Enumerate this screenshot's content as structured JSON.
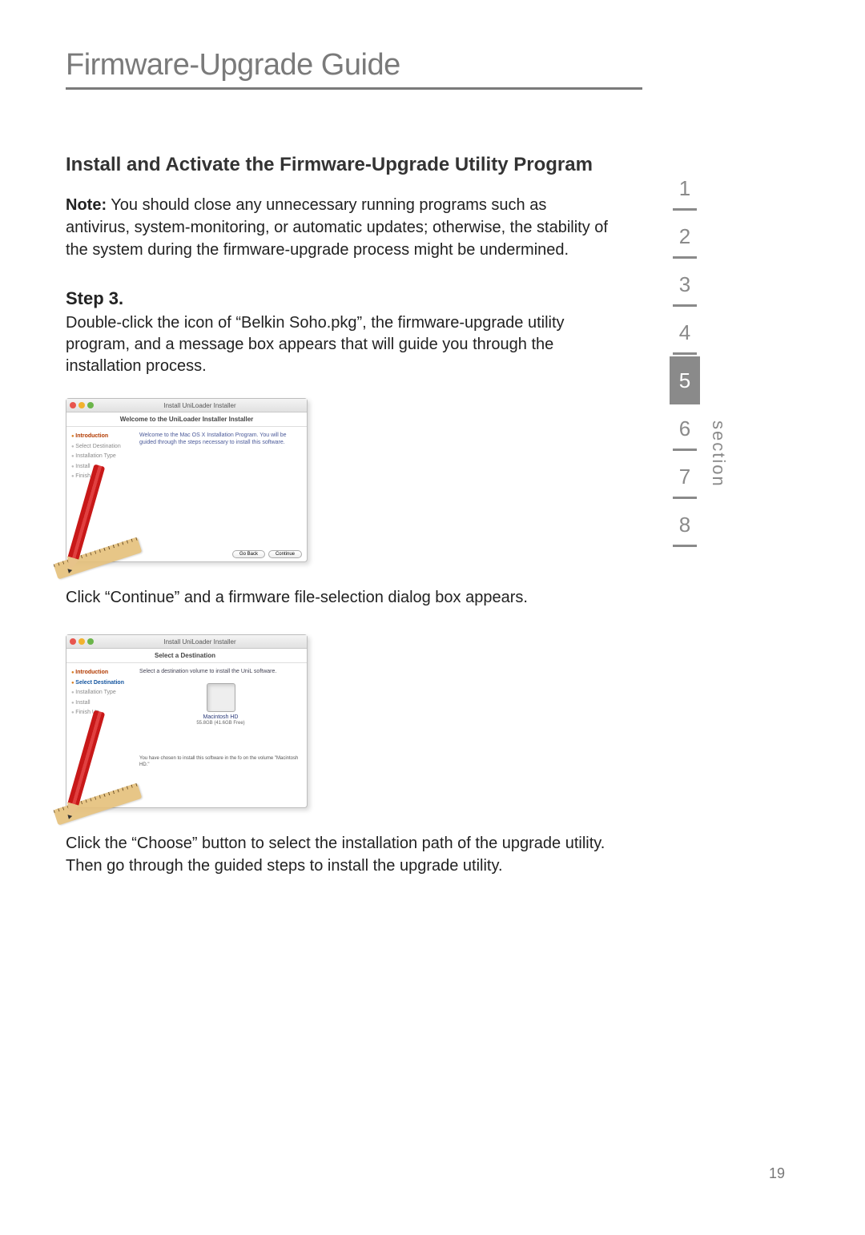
{
  "page_title": "Firmware-Upgrade Guide",
  "section_heading": "Install and Activate the Firmware-Upgrade Utility Program",
  "note_label": "Note:",
  "note_text": " You should close any unnecessary running programs such as antivirus, system-monitoring, or automatic updates; otherwise, the stability of the system during the firmware-upgrade process might be undermined.",
  "step_title": "Step 3.",
  "step_body": "Double-click the icon of “Belkin Soho.pkg”, the firmware-upgrade utility program, and a message box appears that will guide you through the installation process.",
  "after_img_1": "Click “Continue” and a firmware file-selection dialog box appears.",
  "after_img_2": "Click the “Choose” button to select the installation path of the upgrade utility. Then go through the guided steps to install the upgrade utility.",
  "page_number": "19",
  "nav": {
    "label": "section",
    "items": [
      "1",
      "2",
      "3",
      "4",
      "5",
      "6",
      "7",
      "8"
    ],
    "current_index": 4
  },
  "win1": {
    "title": "Install UniLoader Installer",
    "subtitle": "Welcome to the UniLoader Installer Installer",
    "body": "Welcome to the Mac OS X Installation Program. You will be guided through the steps necessary to install this software.",
    "side_intro": "Introduction",
    "side_dest": "Select Destination",
    "side_type": "Installation Type",
    "side_install": "Install",
    "side_finish": "Finish Up",
    "btn_back": "Go Back",
    "btn_continue": "Continue"
  },
  "win2": {
    "title": "Install UniLoader Installer",
    "subtitle": "Select a Destination",
    "body": "Select a destination volume to install the UniL software.",
    "hd_name": "Macintosh HD",
    "hd_stats": "55.8GB (41.6GB Free)",
    "chosen": "You have chosen to install this software in the fo on the volume \"Macintosh HD.\"",
    "side_intro": "Introduction",
    "side_dest": "Select Destination",
    "side_type": "Installation Type",
    "side_install": "Install",
    "side_finish": "Finish Up"
  }
}
